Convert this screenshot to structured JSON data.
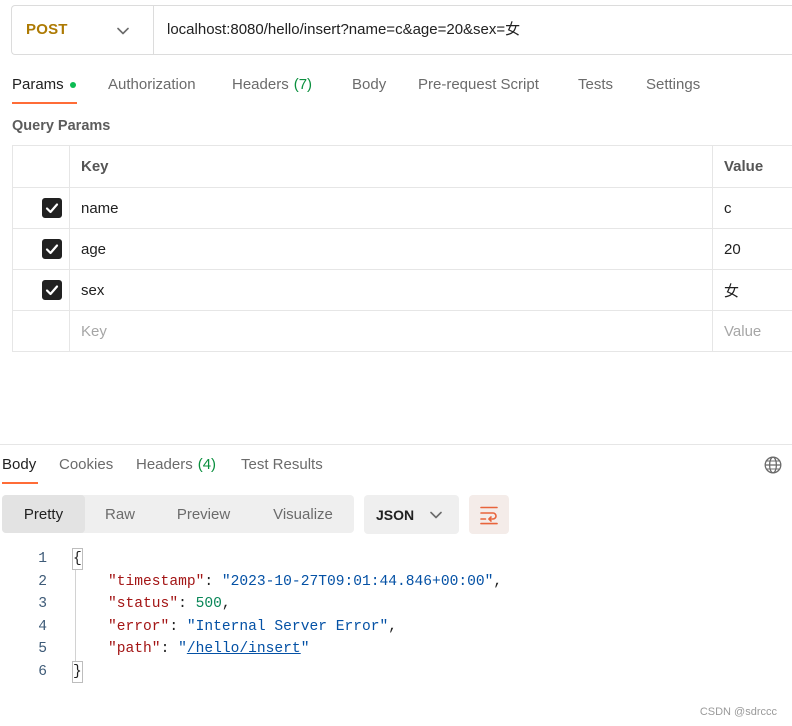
{
  "colors": {
    "accent": "#ff6c37",
    "method_post": "#ad7a03",
    "indicator_green": "#0cbb52",
    "count_green": "#0a8f3e",
    "checkbox": "#212121",
    "json_key": "#a31515",
    "json_string": "#0451a5",
    "json_number": "#098658"
  },
  "icons": {
    "method_dropdown": "chevron-down-icon",
    "param_checkbox": "checkmark-icon",
    "response_language": "globe-icon",
    "format_dropdown": "chevron-down-icon",
    "wrap_toggle": "wrap-lines-icon"
  },
  "request": {
    "method": "POST",
    "url": "localhost:8080/hello/insert?name=c&age=20&sex=女"
  },
  "request_tabs": [
    {
      "label": "Params",
      "active": true
    },
    {
      "label": "Authorization"
    },
    {
      "label": "Headers",
      "count": "(7)"
    },
    {
      "label": "Body"
    },
    {
      "label": "Pre-request Script"
    },
    {
      "label": "Tests"
    },
    {
      "label": "Settings"
    }
  ],
  "query_params": {
    "title": "Query Params",
    "columns": {
      "key": "Key",
      "value": "Value"
    },
    "rows": [
      {
        "key": "name",
        "value": "c",
        "enabled": true
      },
      {
        "key": "age",
        "value": "20",
        "enabled": true
      },
      {
        "key": "sex",
        "value": "女",
        "enabled": true
      }
    ],
    "new_row_placeholder": {
      "key": "Key",
      "value": "Value"
    }
  },
  "response": {
    "tabs": [
      {
        "label": "Body",
        "active": true
      },
      {
        "label": "Cookies"
      },
      {
        "label": "Headers",
        "count": "(4)"
      },
      {
        "label": "Test Results"
      }
    ],
    "view_modes": [
      {
        "label": "Pretty",
        "selected": true
      },
      {
        "label": "Raw"
      },
      {
        "label": "Preview"
      },
      {
        "label": "Visualize"
      }
    ],
    "format": "JSON",
    "body": {
      "line_numbers": [
        "1",
        "2",
        "3",
        "4",
        "5",
        "6"
      ],
      "open_brace": "{",
      "fields": [
        {
          "key": "\"timestamp\"",
          "colon": ": ",
          "value": "\"2023-10-27T09:01:44.846+00:00\"",
          "comma": ","
        },
        {
          "key": "\"status\"",
          "colon": ": ",
          "value": "500",
          "comma": ","
        },
        {
          "key": "\"error\"",
          "colon": ": ",
          "value": "\"Internal Server Error\"",
          "comma": ","
        },
        {
          "key": "\"path\"",
          "colon": ": ",
          "value_quote": "\"",
          "value_link": "/hello/insert"
        }
      ],
      "close_brace": "}"
    }
  },
  "watermark": "CSDN @sdrccc"
}
